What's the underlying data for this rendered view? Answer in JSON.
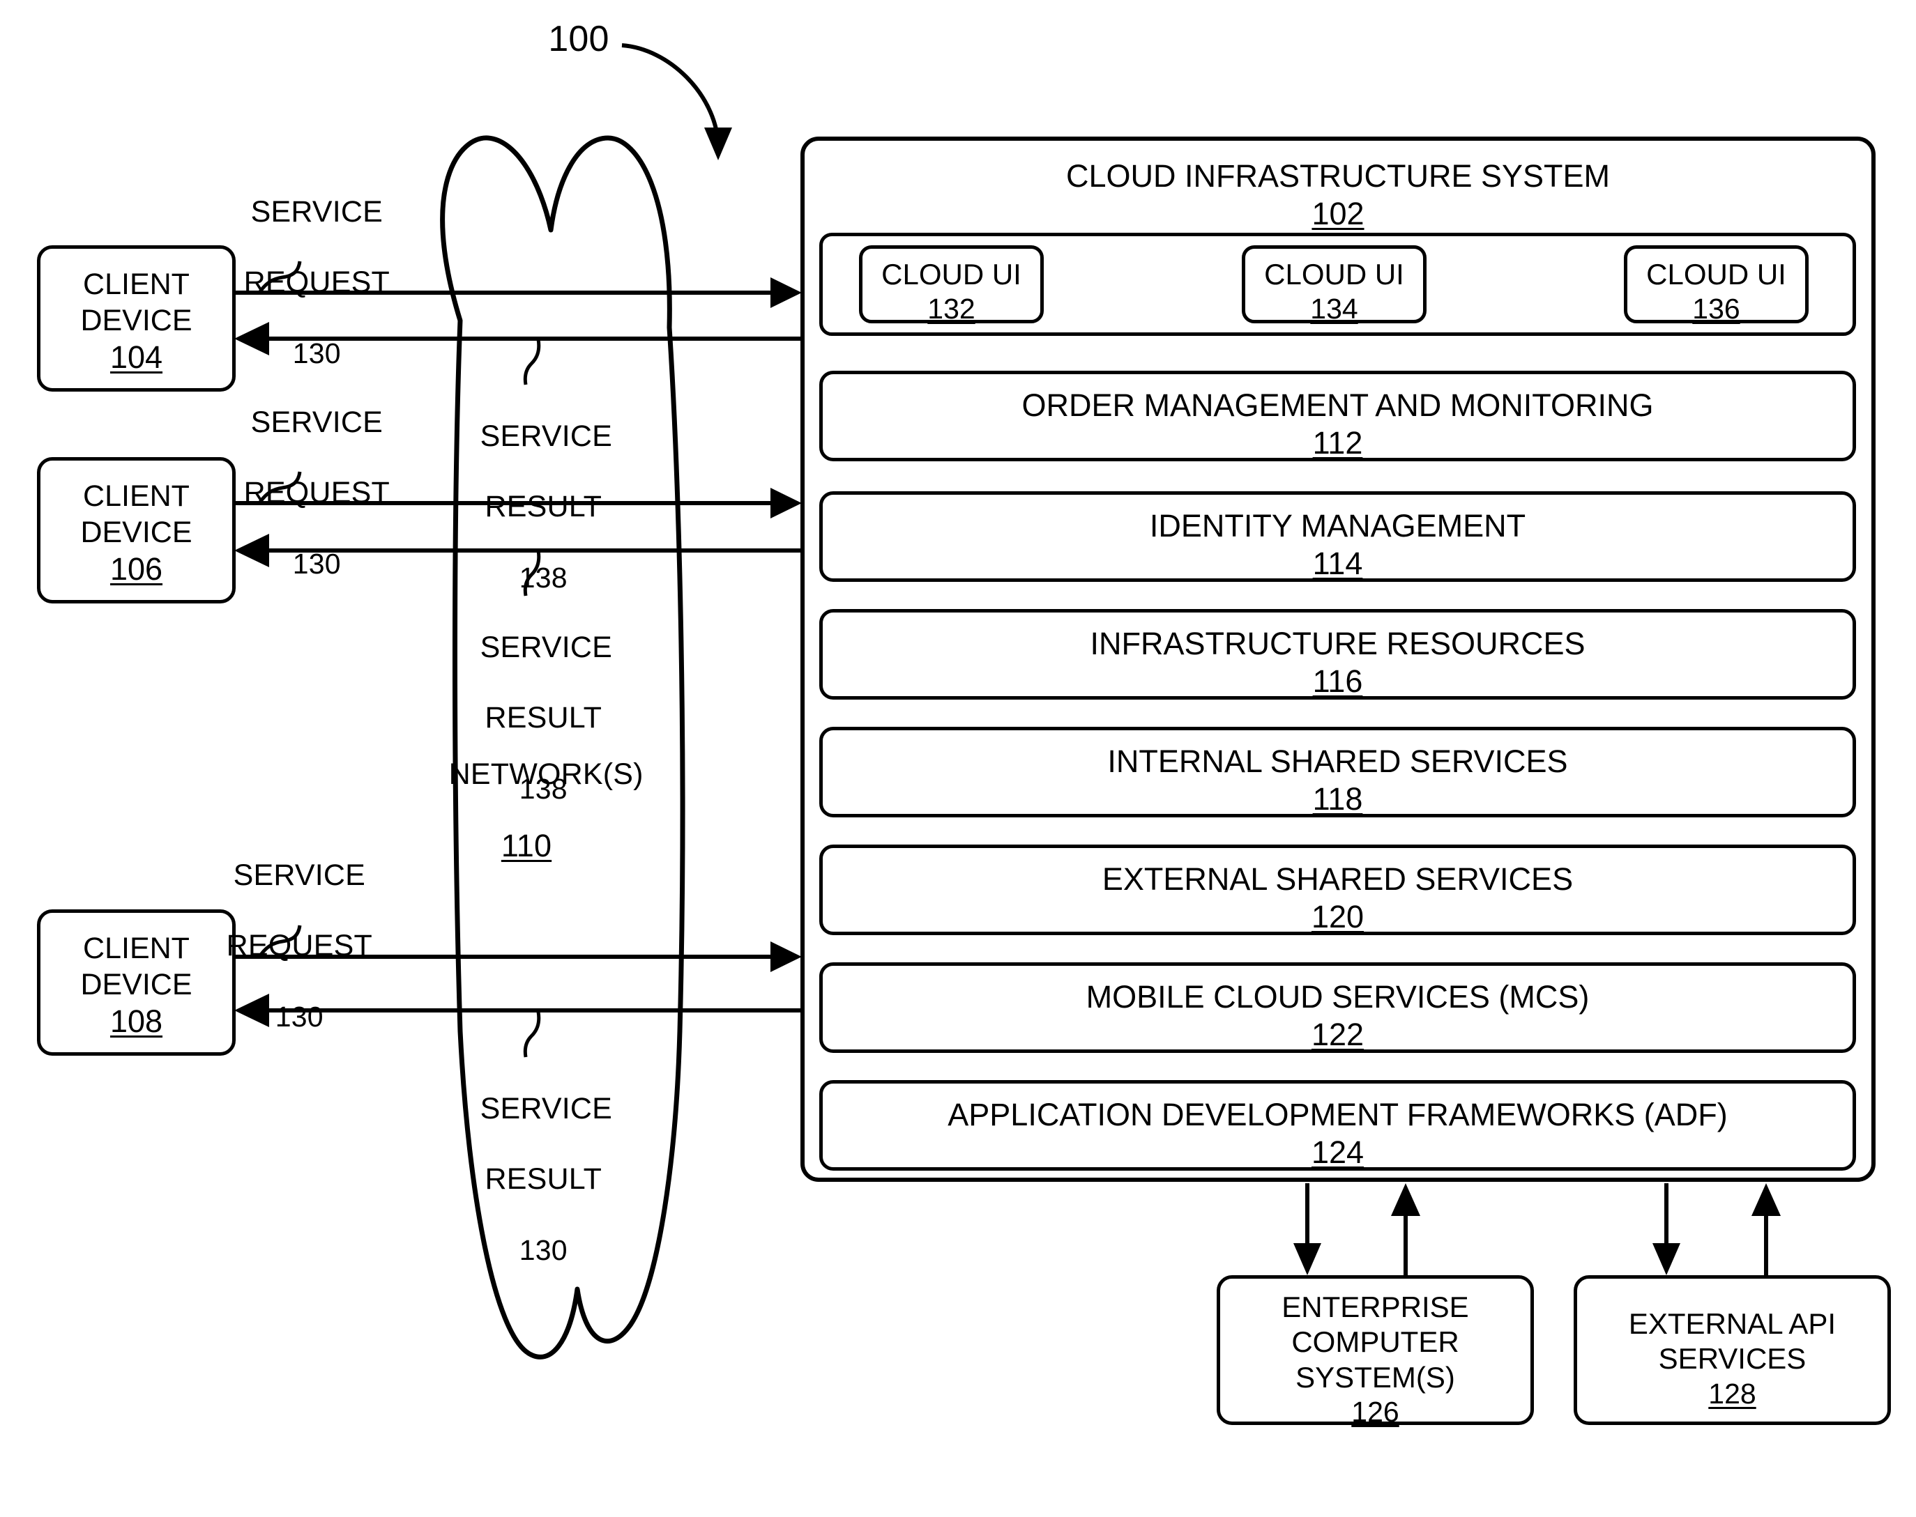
{
  "figure": {
    "reference_numeral": "100"
  },
  "clients": [
    {
      "name": "client-device-104",
      "line1": "CLIENT",
      "line2": "DEVICE",
      "number": "104"
    },
    {
      "name": "client-device-106",
      "line1": "CLIENT",
      "line2": "DEVICE",
      "number": "106"
    },
    {
      "name": "client-device-108",
      "line1": "CLIENT",
      "line2": "DEVICE",
      "number": "108"
    }
  ],
  "flow_labels": [
    {
      "id": "req-104",
      "line1": "SERVICE",
      "line2": "REQUEST",
      "number": "130"
    },
    {
      "id": "req-106",
      "line1": "SERVICE",
      "line2": "REQUEST",
      "number": "130"
    },
    {
      "id": "req-108",
      "line1": "SERVICE",
      "line2": "REQUEST",
      "number": "130"
    },
    {
      "id": "res-top",
      "line1": "SERVICE",
      "line2": "RESULT",
      "number": "138"
    },
    {
      "id": "res-mid",
      "line1": "SERVICE",
      "line2": "RESULT",
      "number": "138"
    },
    {
      "id": "res-bot",
      "line1": "SERVICE",
      "line2": "RESULT",
      "number": "130"
    }
  ],
  "network": {
    "label": "NETWORK(S)",
    "number": "110"
  },
  "cloud_infrastructure_system": {
    "title": "CLOUD INFRASTRUCTURE SYSTEM",
    "number": "102",
    "cloud_uis": [
      {
        "label": "CLOUD UI",
        "number": "132"
      },
      {
        "label": "CLOUD UI",
        "number": "134"
      },
      {
        "label": "CLOUD UI",
        "number": "136"
      }
    ],
    "layers": [
      {
        "label": "ORDER MANAGEMENT AND MONITORING",
        "number": "112"
      },
      {
        "label": "IDENTITY MANAGEMENT",
        "number": "114"
      },
      {
        "label": "INFRASTRUCTURE RESOURCES",
        "number": "116"
      },
      {
        "label": "INTERNAL SHARED SERVICES",
        "number": "118"
      },
      {
        "label": "EXTERNAL SHARED SERVICES",
        "number": "120"
      },
      {
        "label": "MOBILE CLOUD SERVICES (MCS)",
        "number": "122"
      },
      {
        "label": "APPLICATION DEVELOPMENT FRAMEWORKS (ADF)",
        "number": "124"
      }
    ]
  },
  "external_systems": [
    {
      "name": "enterprise-computer-systems",
      "line1": "ENTERPRISE",
      "line2": "COMPUTER",
      "line3": "SYSTEM(S)",
      "number": "126"
    },
    {
      "name": "external-api-services",
      "line1": "EXTERNAL API",
      "line2": "SERVICES",
      "line3": "",
      "number": "128"
    }
  ],
  "colors": {
    "stroke": "#000000",
    "background": "#ffffff"
  }
}
